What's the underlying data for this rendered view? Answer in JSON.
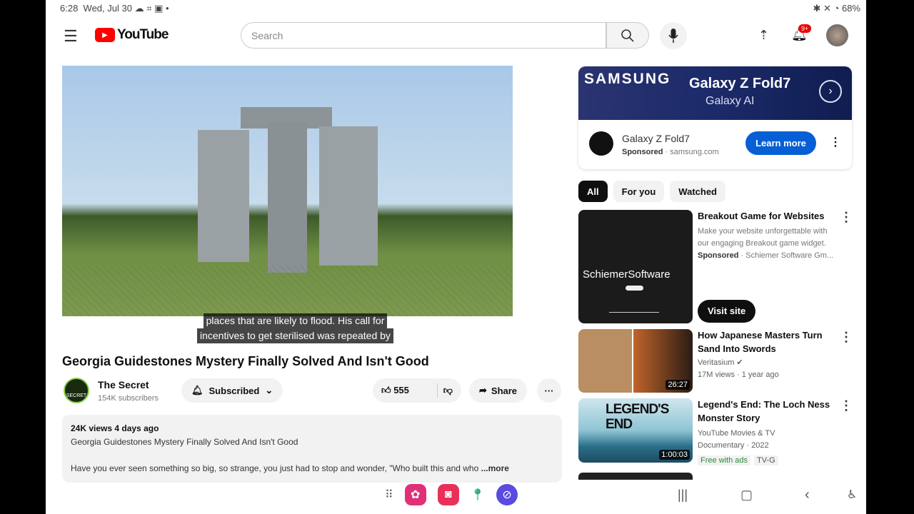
{
  "status_bar": {
    "time": "6:28",
    "date": "Wed, Jul 30",
    "icons": "☁ ⌗ ▣ •",
    "battery": "68%",
    "right_icons": "✱ ✕ ◔"
  },
  "header": {
    "logo": "YouTube",
    "search_placeholder": "Search",
    "notifications_badge": "9+"
  },
  "video": {
    "caption_line1": "places that are likely to flood. His call for",
    "caption_line2": "incentives to get sterilised was repeated by",
    "title": "Georgia Guidestones Mystery Finally Solved And Isn't Good"
  },
  "channel": {
    "name": "The Secret",
    "subscribers": "154K subscribers",
    "avatar_text": "SECRET",
    "subscribe_label": "Subscribed"
  },
  "actions": {
    "likes": "555",
    "share": "Share",
    "more": "···"
  },
  "description": {
    "stats": "24K views  4 days ago",
    "line1": "Georgia Guidestones Mystery Finally Solved And Isn't Good",
    "line2": "Have you ever seen something so big, so strange, you just had to stop and wonder, \"Who built this and who",
    "more": "...more"
  },
  "ad": {
    "brand": "SAMSUNG",
    "headline": "Galaxy Z Fold7",
    "subline": "Galaxy AI",
    "title": "Galaxy Z Fold7",
    "sponsored": "Sponsored",
    "domain": "samsung.com",
    "cta": "Learn more"
  },
  "chips": [
    "All",
    "For you",
    "Watched"
  ],
  "recommendations": [
    {
      "title": "Breakout Game for Websites",
      "desc1": "Make your website unforgettable with",
      "desc2": "our engaging Breakout game widget.",
      "sponsored": "Sponsored",
      "advertiser": "Schiemer Software Gm...",
      "thumb_text": "SchiemerSoftware",
      "cta": "Visit site"
    },
    {
      "title": "How Japanese Masters Turn Sand Into Swords",
      "channel": "Veritasium",
      "meta": "17M views · 1 year ago",
      "duration": "26:27"
    },
    {
      "title": "Legend's End: The Loch Ness Monster Story",
      "channel": "YouTube Movies & TV",
      "meta": "Documentary · 2022",
      "badge1": "Free with ads",
      "badge2": "TV-G",
      "duration": "1:00:03",
      "thumb_text1": "LEGEND'S",
      "thumb_text2": "END"
    }
  ],
  "colors": {
    "accent": "#065fd4",
    "youtube_red": "#ff0000"
  }
}
